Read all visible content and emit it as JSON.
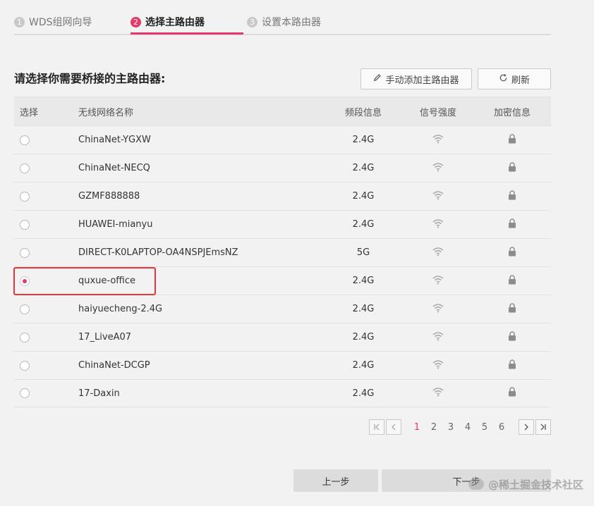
{
  "steps": [
    {
      "num": "1",
      "label": "WDS组网向导"
    },
    {
      "num": "2",
      "label": "选择主路由器"
    },
    {
      "num": "3",
      "label": "设置本路由器"
    }
  ],
  "heading": "请选择你需要桥接的主路由器:",
  "toolbar": {
    "add_label": "手动添加主路由器",
    "refresh_label": "刷新",
    "add_icon": "pencil-icon",
    "refresh_icon": "refresh-icon"
  },
  "table": {
    "headers": {
      "select": "选择",
      "name": "无线网络名称",
      "band": "频段信息",
      "signal": "信号强度",
      "encryption": "加密信息"
    },
    "rows": [
      {
        "name": "ChinaNet-YGXW",
        "band": "2.4G",
        "selected": false
      },
      {
        "name": "ChinaNet-NECQ",
        "band": "2.4G",
        "selected": false
      },
      {
        "name": "GZMF888888",
        "band": "2.4G",
        "selected": false
      },
      {
        "name": "HUAWEI-mianyu",
        "band": "2.4G",
        "selected": false
      },
      {
        "name": "DIRECT-K0LAPTOP-OA4NSPJEmsNZ",
        "band": "5G",
        "selected": false
      },
      {
        "name": "quxue-office",
        "band": "2.4G",
        "selected": true
      },
      {
        "name": "haiyuecheng-2.4G",
        "band": "2.4G",
        "selected": false
      },
      {
        "name": "17_LiveA07",
        "band": "2.4G",
        "selected": false
      },
      {
        "name": "ChinaNet-DCGP",
        "band": "2.4G",
        "selected": false
      },
      {
        "name": "17-Daxin",
        "band": "2.4G",
        "selected": false
      }
    ]
  },
  "pagination": {
    "pages": [
      "1",
      "2",
      "3",
      "4",
      "5",
      "6"
    ],
    "current": "1"
  },
  "footer": {
    "prev_label": "上一步",
    "next_label": "下一步"
  },
  "watermark": "@稀土掘金技术社区",
  "colors": {
    "accent": "#e6396b",
    "highlight_border": "#e53935"
  }
}
